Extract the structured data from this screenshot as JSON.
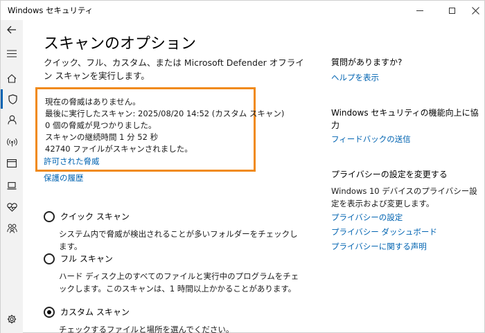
{
  "window": {
    "title": "Windows セキュリティ"
  },
  "sidebar": {
    "items": [
      {
        "icon": "back-arrow-icon"
      },
      {
        "icon": "hamburger-menu-icon"
      },
      {
        "icon": "home-icon"
      },
      {
        "icon": "shield-icon"
      },
      {
        "icon": "person-icon"
      },
      {
        "icon": "wireless-icon"
      },
      {
        "icon": "app-browser-icon"
      },
      {
        "icon": "laptop-icon"
      },
      {
        "icon": "heart-pulse-icon"
      },
      {
        "icon": "family-icon"
      },
      {
        "icon": "gear-icon"
      }
    ]
  },
  "main": {
    "title": "スキャンのオプション",
    "description": "クイック、フル、カスタム、または Microsoft Defender オフライン スキャンを実行します。",
    "status": {
      "line1": "現在の脅威はありません。",
      "line2": "最後に実行したスキャン: 2025/08/20 14:52 (カスタム スキャン)",
      "line3": "0 個の脅威が見つかりました。",
      "line4": "スキャンの継続時間 1 分 52 秒",
      "line5": "42740 ファイルがスキャンされました。"
    },
    "links": {
      "allowed_threats": "許可された脅威",
      "protection_history": "保護の履歴"
    },
    "options": [
      {
        "label": "クイック スキャン",
        "description": "システム内で脅威が検出されることが多いフォルダーをチェックします。",
        "selected": false
      },
      {
        "label": "フル スキャン",
        "description": "ハード ディスク上のすべてのファイルと実行中のプログラムをチェックします。このスキャンは、1 時間以上かかることがあります。",
        "selected": false
      },
      {
        "label": "カスタム スキャン",
        "description": "チェックするファイルと場所を選んでください。",
        "selected": true
      }
    ]
  },
  "right": {
    "help_heading": "質問がありますか?",
    "help_link": "ヘルプを表示",
    "improve_heading": "Windows セキュリティの機能向上に協力",
    "feedback_link": "フィードバックの送信",
    "privacy_heading": "プライバシーの設定を変更する",
    "privacy_text": "Windows 10 デバイスのプライバシー設定を表示および変更します。",
    "privacy_settings_link": "プライバシーの設定",
    "privacy_dashboard_link": "プライバシー ダッシュボード",
    "privacy_statement_link": "プライバシーに関する声明"
  },
  "colors": {
    "accent": "#0063b1",
    "highlight_border": "#f08a1a"
  }
}
